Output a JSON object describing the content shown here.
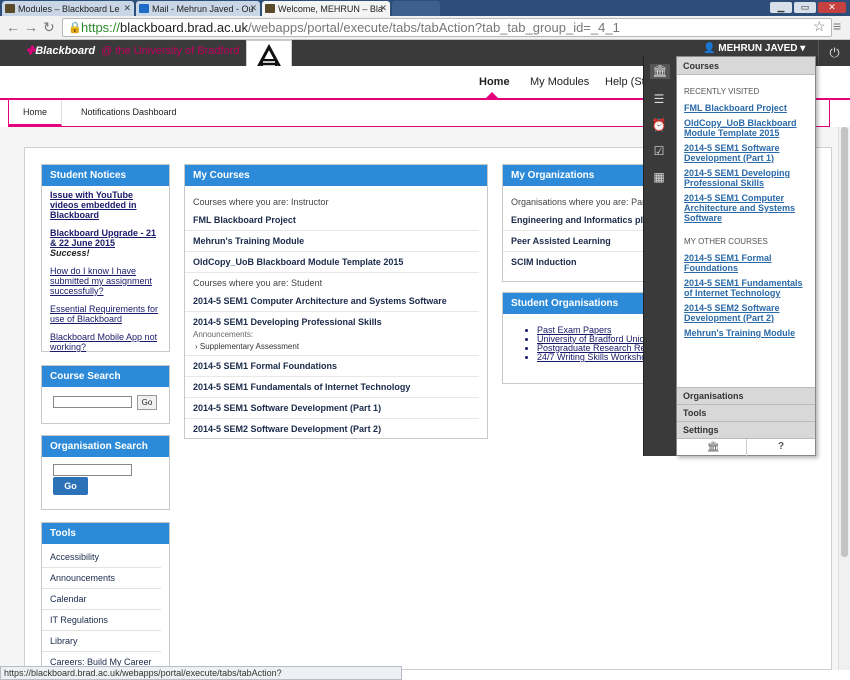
{
  "browser": {
    "tabs": [
      {
        "label": "Modules – Blackboard Le",
        "fav": "#5a4a2a"
      },
      {
        "label": "Mail - Mehrun Javed - Ou",
        "fav": "#1e6cc8"
      },
      {
        "label": "Welcome, MEHRUN – Bla",
        "fav": "#5a4a2a"
      }
    ],
    "url_scheme": "https://",
    "url_host": "blackboard.brad.ac.uk",
    "url_path": "/webapps/portal/execute/tabs/tabAction?tab_tab_group_id=_4_1"
  },
  "header": {
    "brand": "Blackboard",
    "brand_sub": "@ the University of Bradford",
    "user": "MEHRUN JAVED"
  },
  "top_tabs": [
    "Home",
    "My Modules",
    "Help (Stu"
  ],
  "sub_tabs": [
    "Home",
    "Notifications Dashboard"
  ],
  "student_notices": {
    "title": "Student Notices",
    "items": [
      "Issue with YouTube videos embedded in Blackboard",
      "Blackboard Upgrade - 21 & 22 June 2015",
      "How do I know I have submitted my assignment successfully?",
      "Essential Requirements for use of Blackboard",
      "Blackboard Mobile App not working?"
    ],
    "success_suffix": "Success!"
  },
  "course_search": {
    "title": "Course Search",
    "go": "Go"
  },
  "org_search": {
    "title": "Organisation Search",
    "go": "Go"
  },
  "tools": {
    "title": "Tools",
    "items": [
      "Accessibility",
      "Announcements",
      "Calendar",
      "IT Regulations",
      "Library",
      "Careers: Build My Career"
    ]
  },
  "my_courses": {
    "title": "My Courses",
    "instructor_label": "Courses where you are: Instructor",
    "instructor": [
      "FML Blackboard Project",
      "Mehrun's Training Module",
      "OldCopy_UoB Blackboard Module Template 2015"
    ],
    "student_label": "Courses where you are: Student",
    "student_a": [
      "2014-5 SEM1 Computer Architecture and Systems Software",
      "2014-5 SEM1 Developing Professional Skills"
    ],
    "ann_label": "Announcements:",
    "ann_item": "Supplementary Assessment",
    "student_b": [
      "2014-5 SEM1 Formal Foundations",
      "2014-5 SEM1 Fundamentals of Internet Technology",
      "2014-5 SEM1 Software Development (Part 1)",
      "2014-5 SEM2 Software Development (Part 2)"
    ]
  },
  "my_orgs": {
    "title": "My Organizations",
    "label": "Organisations where you are: Partic",
    "items": [
      "Engineering and Informatics pla",
      "Peer Assisted Learning",
      "SCIM Induction"
    ]
  },
  "student_orgs": {
    "title": "Student Organisations",
    "items": [
      "Past Exam Papers",
      "University of Bradford Union",
      "Postgraduate Research Re",
      "24/7 Writing Skills Worksho"
    ]
  },
  "flyout": {
    "header": "Courses",
    "recent_label": "RECENTLY VISITED",
    "recent": [
      "FML Blackboard Project",
      "OldCopy_UoB Blackboard Module Template 2015",
      "2014-5 SEM1 Software Development (Part 1)",
      "2014-5 SEM1 Developing Professional Skills",
      "2014-5 SEM1 Computer Architecture and Systems Software"
    ],
    "other_label": "MY OTHER COURSES",
    "other": [
      "2014-5 SEM1 Formal Foundations",
      "2014-5 SEM1 Fundamentals of Internet Technology",
      "2014-5 SEM2 Software Development (Part 2)",
      "Mehrun's Training Module"
    ],
    "footer": [
      "Organisations",
      "Tools",
      "Settings"
    ],
    "help": "?"
  },
  "status_url": "https://blackboard.brad.ac.uk/webapps/portal/execute/tabs/tabAction?tab_tab_group_id=_4_1#global-nav-flyout"
}
